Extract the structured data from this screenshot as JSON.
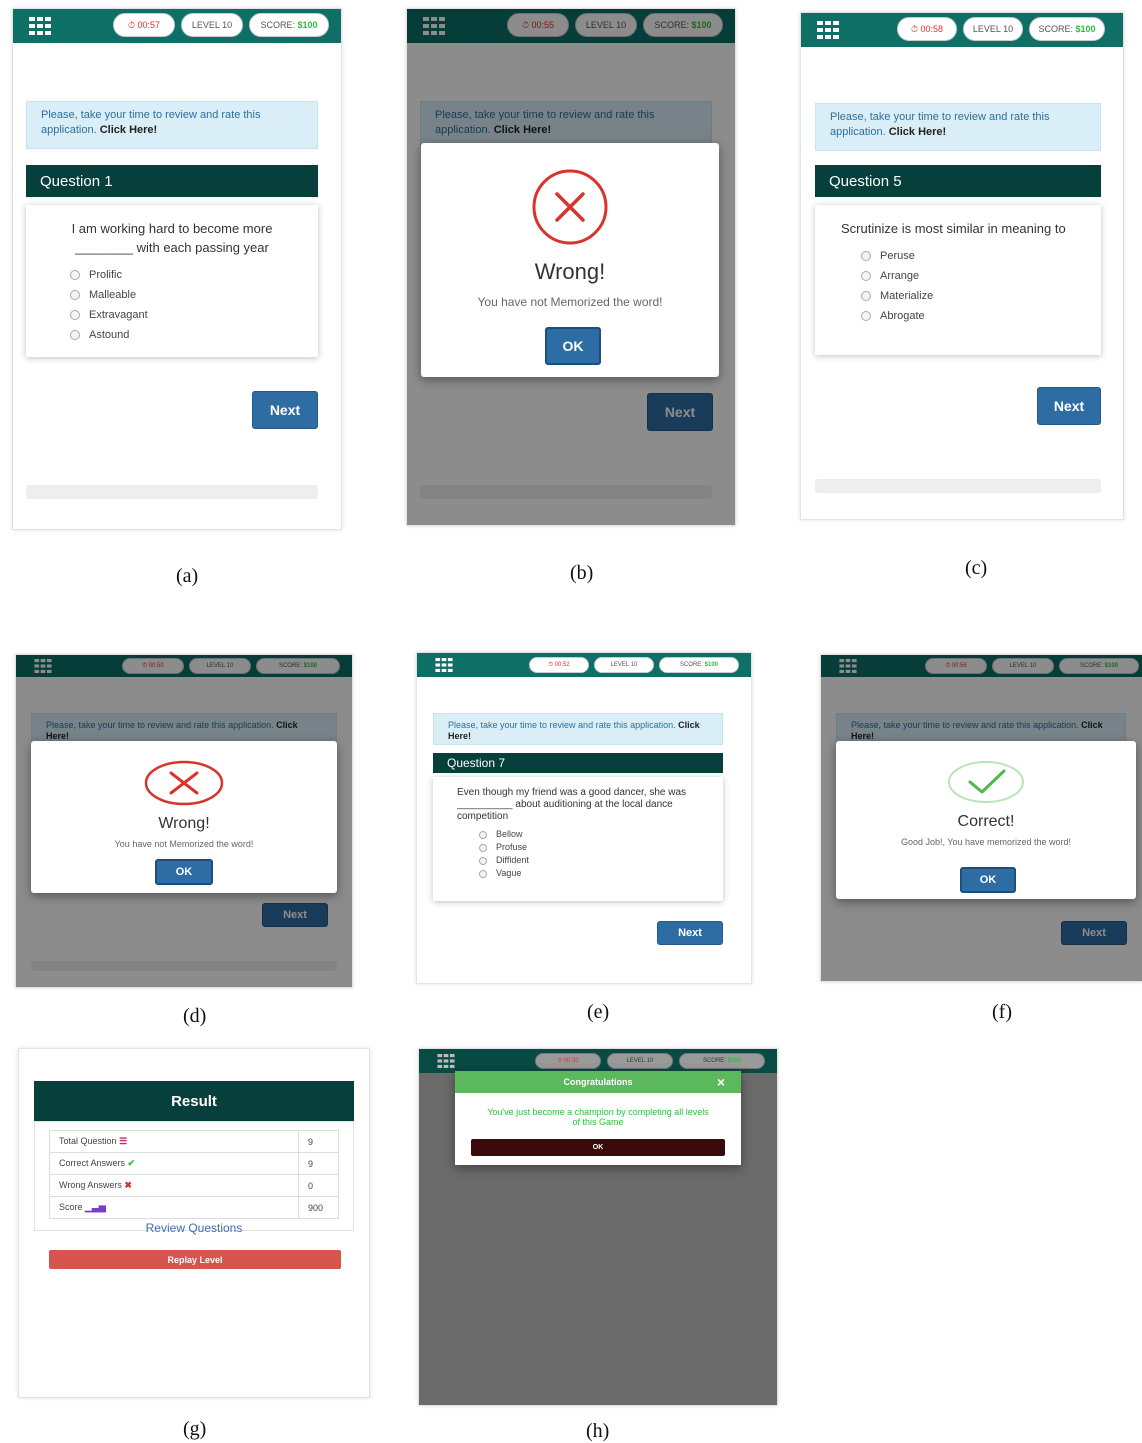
{
  "colors": {
    "topbar": "#0e6f66",
    "question_header": "#063f3b",
    "primary_button": "#2e6da4",
    "wrong": "#d9342b",
    "correct": "#2dbe3b",
    "danger_button": "#d9534f",
    "congrats_header": "#5cb85c"
  },
  "rate_alert": {
    "text": "Please, take your time to review and rate this application.",
    "link": "Click Here!"
  },
  "captions": {
    "a": "(a)",
    "b": "(b)",
    "c": "(c)",
    "d": "(d)",
    "e": "(e)",
    "f": "(f)",
    "g": "(g)",
    "h": "(h)"
  },
  "screen_a": {
    "timer": "00:57",
    "level": "LEVEL 10",
    "score_label": "SCORE:",
    "score_value": "$100",
    "question_title": "Question 1",
    "question_text": "I am working hard to become more ________ with each passing year",
    "options": [
      "Prolific",
      "Malleable",
      "Extravagant",
      "Astound"
    ],
    "next": "Next"
  },
  "screen_b": {
    "timer": "00:55",
    "level": "LEVEL 10",
    "score_label": "SCORE:",
    "score_value": "$100",
    "modal_title": "Wrong!",
    "modal_text": "You have not Memorized the word!",
    "ok": "OK",
    "next": "Next"
  },
  "screen_c": {
    "timer": "00:58",
    "level": "LEVEL 10",
    "score_label": "SCORE:",
    "score_value": "$100",
    "question_title": "Question 5",
    "question_text": "Scrutinize is most similar in meaning to",
    "options": [
      "Peruse",
      "Arrange",
      "Materialize",
      "Abrogate"
    ],
    "next": "Next"
  },
  "screen_d": {
    "timer": "00:50",
    "level": "LEVEL 10",
    "score_label": "SCORE:",
    "score_value": "$100",
    "modal_title": "Wrong!",
    "modal_text": "You have not Memorized the word!",
    "ok": "OK",
    "next": "Next"
  },
  "screen_e": {
    "timer": "00:52",
    "level": "LEVEL 10",
    "score_label": "SCORE:",
    "score_value": "$100",
    "question_title": "Question 7",
    "question_text": "Even though my friend was a good dancer, she was __________ about auditioning at the local dance competition",
    "options": [
      "Bellow",
      "Profuse",
      "Diffident",
      "Vague"
    ],
    "next": "Next"
  },
  "screen_f": {
    "timer": "00:56",
    "level": "LEVEL 10",
    "score_label": "SCORE:",
    "score_value": "$100",
    "modal_title": "Correct!",
    "modal_text": "Good Job!, You have memorized the word!",
    "ok": "OK",
    "next": "Next"
  },
  "screen_g": {
    "title": "Result",
    "rows": [
      {
        "label": "Total Question",
        "value": "9",
        "icon": "list-icon"
      },
      {
        "label": "Correct Answers",
        "value": "9",
        "icon": "check-icon"
      },
      {
        "label": "Wrong Answers",
        "value": "0",
        "icon": "cross-icon"
      },
      {
        "label": "Score",
        "value": "900",
        "icon": "bar-chart-icon"
      }
    ],
    "review": "Review Questions",
    "replay": "Replay Level"
  },
  "screen_h": {
    "timer": "00:30",
    "level": "LEVEL 10",
    "score_label": "SCORE:",
    "score_value": "$100",
    "modal_title": "Congratulations",
    "modal_text": "You've just become a champion by completing all levels of this Game",
    "ok": "OK",
    "close_symbol": "×"
  }
}
